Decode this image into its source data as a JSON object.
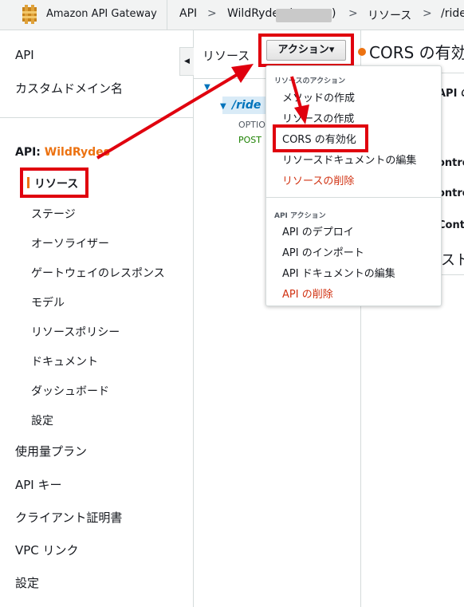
{
  "topbar": {
    "app_title": "Amazon API Gateway",
    "breadcrumb": [
      "API",
      ">",
      "WildRydes (",
      ")",
      ">",
      "リソース",
      ">",
      "/ride"
    ]
  },
  "sidebar": {
    "items_top": [
      "API",
      "カスタムドメイン名"
    ],
    "api_prefix": "API:",
    "api_name": "WildRydes",
    "active": "リソース",
    "sub_items": [
      "ステージ",
      "オーソライザー",
      "ゲートウェイのレスポンス",
      "モデル",
      "リソースポリシー",
      "ドキュメント",
      "ダッシュボード",
      "設定"
    ],
    "items_bottom": [
      "使用量プラン",
      "API キー",
      "クライアント証明書",
      "VPC リンク",
      "設定"
    ]
  },
  "resources_panel": {
    "title": "リソース",
    "collapse_icon": "◀",
    "actions_button": "アクション▾",
    "selected_resource": "/ride",
    "methods": [
      "OPTIO",
      "POST"
    ]
  },
  "main": {
    "title": "CORS の有効",
    "fragments": [
      "API の",
      "ontro",
      "ontro",
      "Cont",
      "スト"
    ]
  },
  "dropdown": {
    "resource_header": "リソースのアクション",
    "resource_items": [
      "メソッドの作成",
      "リソースの作成",
      "CORS の有効化",
      "リソースドキュメントの編集",
      "リソースの削除"
    ],
    "api_header": "API アクション",
    "api_items": [
      "API のデプロイ",
      "API のインポート",
      "API ドキュメントの編集",
      "API の削除"
    ]
  },
  "colors": {
    "accent_orange": "#ec7211",
    "highlight_red": "#e0000e",
    "link_blue": "#0073bb",
    "danger_red": "#d13212",
    "post_green": "#1d8102"
  }
}
